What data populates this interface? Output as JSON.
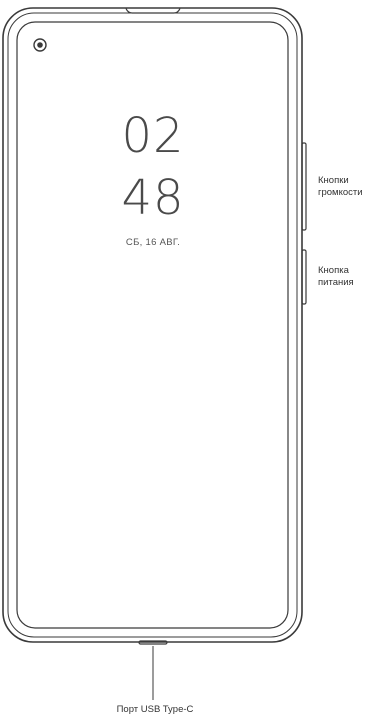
{
  "lockscreen": {
    "hours": "02",
    "minutes": "48",
    "date": "СБ, 16 АВГ."
  },
  "callouts": {
    "volume_line1": "Кнопки",
    "volume_line2": "громкости",
    "power_line1": "Кнопка",
    "power_line2": "питания",
    "usb_port": "Порт USB Type-C"
  },
  "colors": {
    "outline": "#3a3a3a",
    "text": "#333333"
  }
}
